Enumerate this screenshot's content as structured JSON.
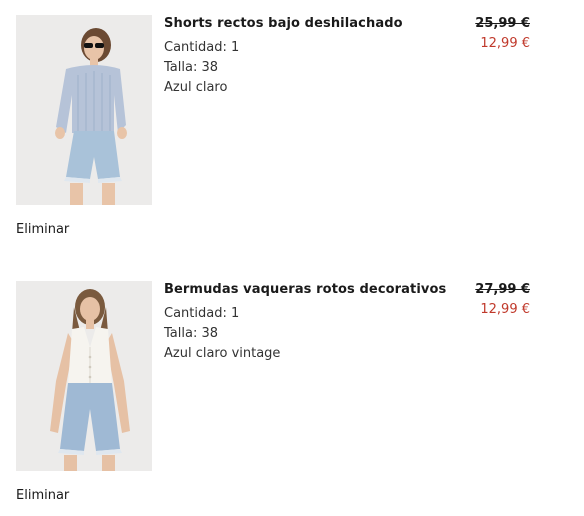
{
  "cart": {
    "items": [
      {
        "name": "Shorts rectos bajo deshilachado",
        "quantity": "Cantidad: 1",
        "size": "Talla: 38",
        "color": "Azul claro",
        "price_original": "25,99 €",
        "price_sale": "12,99 €",
        "remove_label": "Eliminar"
      },
      {
        "name": "Bermudas vaqueras rotos decorativos",
        "quantity": "Cantidad: 1",
        "size": "Talla: 38",
        "color": "Azul claro vintage",
        "price_original": "27,99 €",
        "price_sale": "12,99 €",
        "remove_label": "Eliminar"
      }
    ]
  },
  "colors": {
    "sale_price": "#c0392b",
    "image_background": "#ecebea"
  }
}
